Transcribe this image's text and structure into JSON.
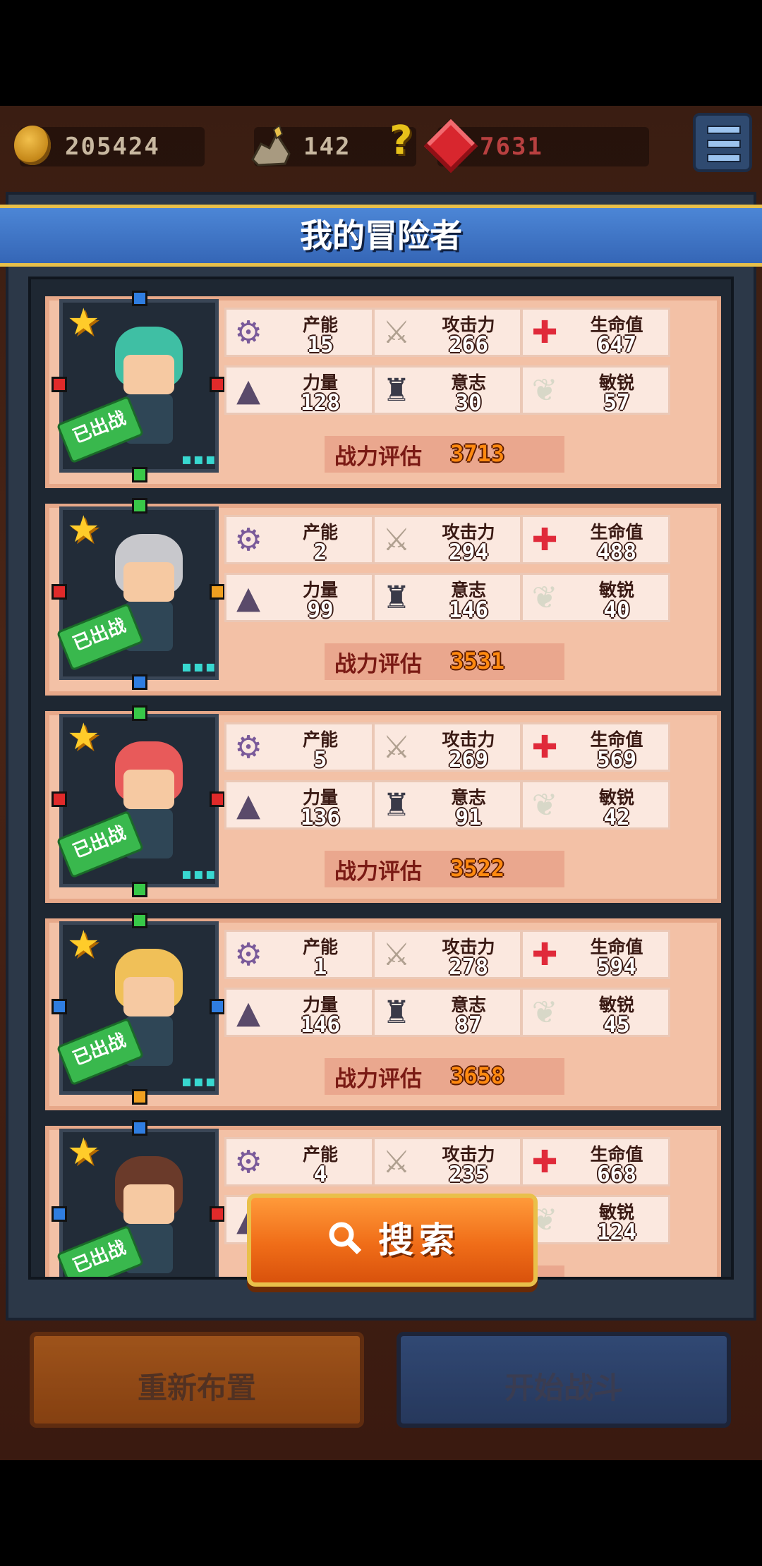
{
  "currency": {
    "coins": "205424",
    "ore": "142",
    "mystery": "?",
    "gems": "7631"
  },
  "panel": {
    "title": "我的冒险者"
  },
  "labels": {
    "productivity": "产能",
    "attack": "攻击力",
    "hp": "生命值",
    "strength": "力量",
    "will": "意志",
    "agility": "敏锐",
    "power": "战力评估",
    "deployed": "已出战"
  },
  "adventurers": [
    {
      "productivity": "15",
      "attack": "266",
      "hp": "647",
      "strength": "128",
      "will": "30",
      "agility": "57",
      "power": "3713"
    },
    {
      "productivity": "2",
      "attack": "294",
      "hp": "488",
      "strength": "99",
      "will": "146",
      "agility": "40",
      "power": "3531"
    },
    {
      "productivity": "5",
      "attack": "269",
      "hp": "569",
      "strength": "136",
      "will": "91",
      "agility": "42",
      "power": "3522"
    },
    {
      "productivity": "1",
      "attack": "278",
      "hp": "594",
      "strength": "146",
      "will": "87",
      "agility": "45",
      "power": "3658"
    },
    {
      "productivity": "4",
      "attack": "235",
      "hp": "668",
      "strength": "",
      "will": "",
      "agility": "124",
      "power": ""
    }
  ],
  "buttons": {
    "search": "搜索",
    "reset": "重新布置",
    "start": "开始战斗"
  },
  "colors": {
    "panel_header": "#3f78cc",
    "card_bg": "#f3c1a6",
    "search_button": "#f07a1e",
    "deployed_badge": "#39b84d"
  },
  "icons": {
    "productivity": "pickaxe-shield-icon",
    "attack": "sword-icon",
    "hp": "red-cross-icon",
    "strength": "anvil-icon",
    "will": "statue-icon",
    "agility": "wings-icon"
  }
}
